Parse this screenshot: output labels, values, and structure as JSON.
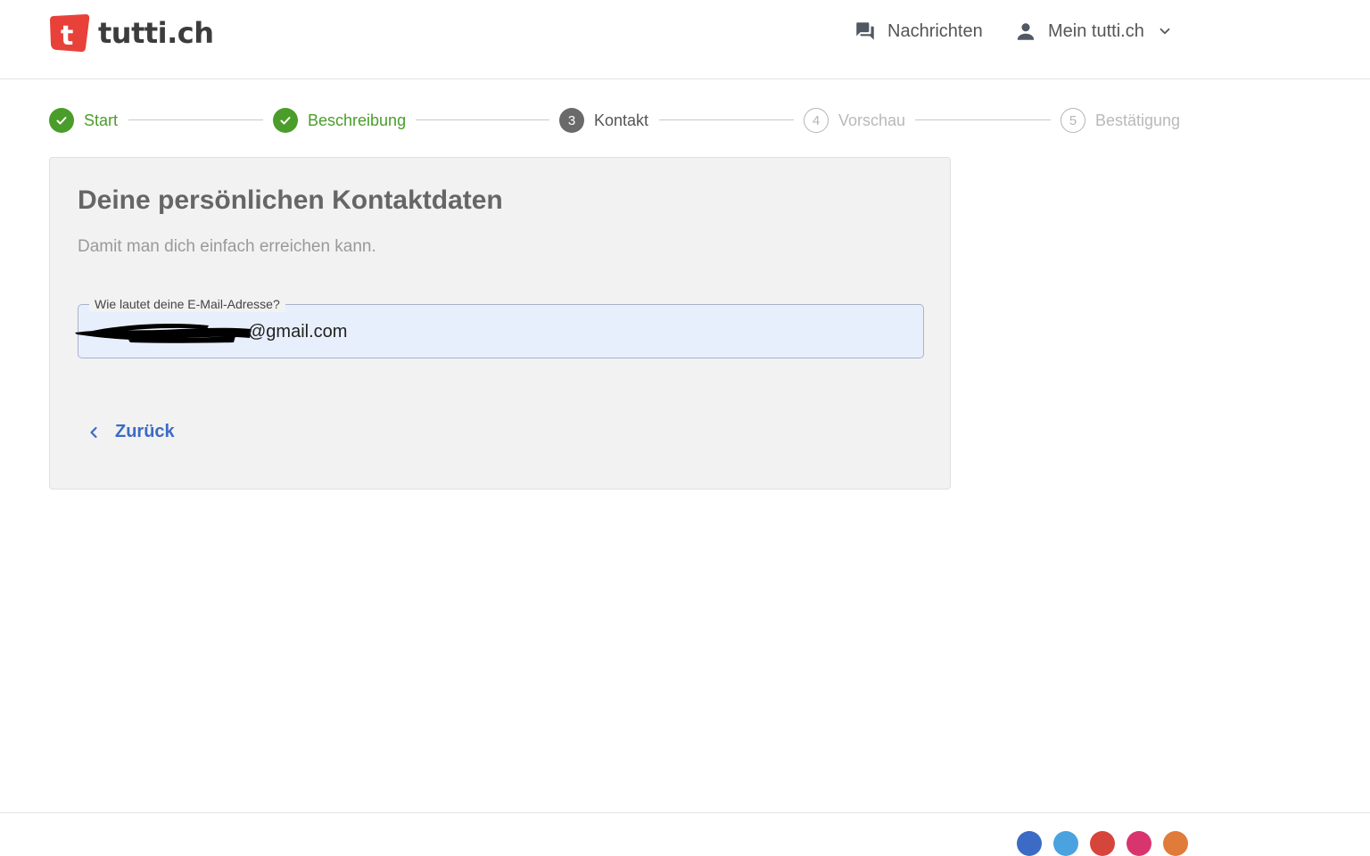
{
  "header": {
    "logo_text": "tutti.ch",
    "logo_mark": "t",
    "messages_label": "Nachrichten",
    "account_label": "Mein tutti.ch",
    "colors": {
      "brand": "#e8413a",
      "text": "#3c3c3c"
    }
  },
  "stepper": {
    "steps": [
      {
        "label": "Start",
        "state": "done"
      },
      {
        "label": "Beschreibung",
        "state": "done"
      },
      {
        "number": "3",
        "label": "Kontakt",
        "state": "active"
      },
      {
        "number": "4",
        "label": "Vorschau",
        "state": "todo"
      },
      {
        "number": "5",
        "label": "Bestätigung",
        "state": "todo"
      }
    ],
    "colors": {
      "done": "#4a9d2a",
      "active": "#6a6a6a",
      "todo": "#b5b5b5"
    }
  },
  "card": {
    "title": "Deine persönlichen Kontaktdaten",
    "subtitle": "Damit man dich einfach erreichen kann.",
    "email_label": "Wie lautet deine E-Mail-Adresse?",
    "email_value": "@gmail.com",
    "back_label": "Zurück",
    "colors": {
      "link": "#3b6bc4",
      "field_bg": "#e8effc"
    }
  },
  "footer": {
    "social_colors": [
      "#3b6bc4",
      "#4aa3df",
      "#d6453b",
      "#d8356e",
      "#e07b39"
    ]
  }
}
